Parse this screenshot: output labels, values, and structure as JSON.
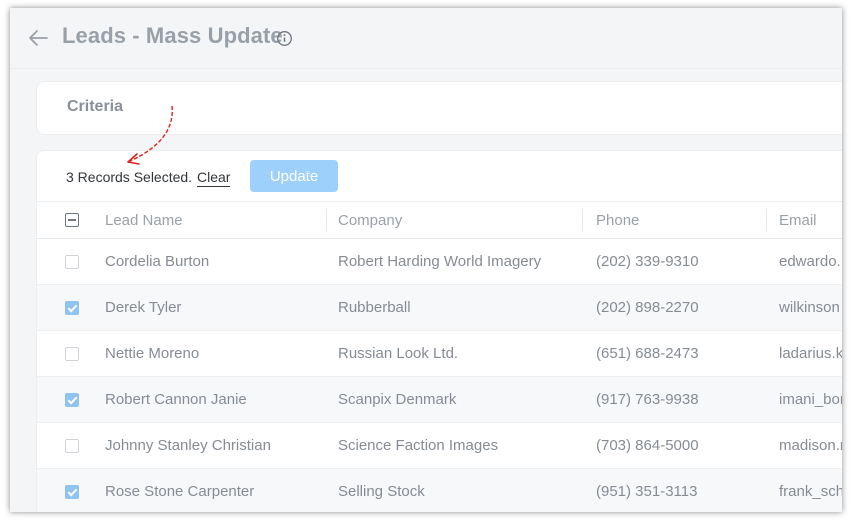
{
  "header": {
    "title": "Leads - Mass Update",
    "back_icon": "arrow-left-icon",
    "info_icon": "info-circle-icon"
  },
  "criteria": {
    "label": "Criteria"
  },
  "toolbar": {
    "selected_text": "3 Records Selected.",
    "clear_label": "Clear",
    "update_label": "Update"
  },
  "table": {
    "columns": [
      "Lead Name",
      "Company",
      "Phone",
      "Email"
    ],
    "rows": [
      {
        "name": "Cordelia Burton",
        "company": "Robert Harding World Imagery",
        "phone": "(202) 339-9310",
        "email": "edwardo.",
        "checked": false
      },
      {
        "name": "Derek Tyler",
        "company": "Rubberball",
        "phone": "(202) 898-2270",
        "email": "wilkinson",
        "checked": true
      },
      {
        "name": "Nettie Moreno",
        "company": "Russian Look Ltd.",
        "phone": "(651) 688-2473",
        "email": "ladarius.k",
        "checked": false
      },
      {
        "name": "Robert Cannon Janie",
        "company": "Scanpix Denmark",
        "phone": "(917) 763-9938",
        "email": "imani_bor",
        "checked": true
      },
      {
        "name": "Johnny Stanley Christian",
        "company": "Science Faction Images",
        "phone": "(703) 864-5000",
        "email": "madison.r",
        "checked": false
      },
      {
        "name": "Rose Stone Carpenter",
        "company": "Selling Stock",
        "phone": "(951) 351-3113",
        "email": "frank_sch",
        "checked": true
      }
    ]
  },
  "colors": {
    "accent": "#9dd0fb",
    "annotation": "#e0201b",
    "checked": "#8fc3f1"
  }
}
